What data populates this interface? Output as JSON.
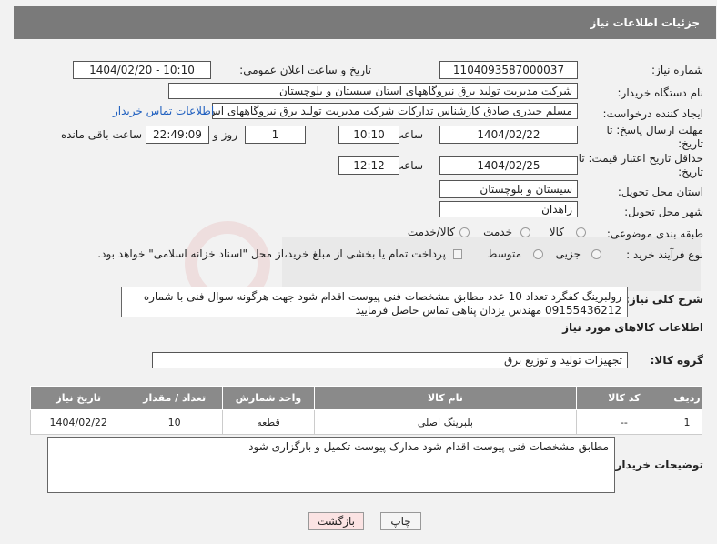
{
  "header": {
    "title": "جزئیات اطلاعات نیاز"
  },
  "fields": {
    "need_number": {
      "label": "شماره نیاز:",
      "value": "1104093587000037"
    },
    "announce": {
      "label": "تاریخ و ساعت اعلان عمومی:",
      "value": "1404/02/20 - 10:10"
    },
    "buyer_org": {
      "label": "نام دستگاه خریدار:",
      "value": "شرکت مدیریت تولید برق نیروگاههای استان سیستان و بلوچستان"
    },
    "creator": {
      "label": "ایجاد کننده درخواست:",
      "value": "مسلم حیدری صادق کارشناس تدارکات شرکت مدیریت تولید برق نیروگاههای اس",
      "contact_link": "اطلاعات تماس خریدار"
    },
    "deadline": {
      "label": "مهلت ارسال پاسخ: تا تاریخ:",
      "date": "1404/02/22",
      "time_label": "ساعت",
      "time": "10:10",
      "days": "1",
      "days_label": "روز و",
      "remaining": "22:49:09",
      "remaining_label": "ساعت باقی مانده"
    },
    "price_validity": {
      "label": "حداقل تاریخ اعتبار قیمت: تا تاریخ:",
      "date": "1404/02/25",
      "time_label": "ساعت",
      "time": "12:12"
    },
    "province": {
      "label": "استان محل تحویل:",
      "value": "سیستان و بلوچستان"
    },
    "city": {
      "label": "شهر محل تحویل:",
      "value": "زاهدان"
    },
    "category": {
      "label": "طبقه بندی موضوعی:",
      "options": [
        "کالا",
        "خدمت",
        "کالا/خدمت"
      ],
      "selected": "کالا"
    },
    "process": {
      "label": "نوع فرآیند خرید :",
      "options": [
        "جزیی",
        "متوسط"
      ],
      "selected": "جزیی",
      "checkbox_text": "پرداخت تمام یا بخشی از مبلغ خرید،از محل \"اسناد خزانه اسلامی\" خواهد بود."
    }
  },
  "summary": {
    "label": "شرح کلی نیاز:",
    "text": "رولبرینگ کفگرد  تعداد  10 عدد   مطابق مشخصات فنی پیوست اقدام شود جهت هرگونه سوال فنی با شماره 09155436212 مهندس یزدان پناهی تماس حاصل فرمایید"
  },
  "goods_info_title": "اطلاعات کالاهای مورد نیاز",
  "goods_group": {
    "label": "گروه کالا:",
    "value": "تجهیزات تولید و توزیع برق"
  },
  "table": {
    "headers": [
      "ردیف",
      "کد کالا",
      "نام کالا",
      "واحد شمارش",
      "تعداد / مقدار",
      "تاریخ نیاز"
    ],
    "rows": [
      [
        "1",
        "--",
        "بلبرینگ اصلی",
        "قطعه",
        "10",
        "1404/02/22"
      ]
    ]
  },
  "buyer_notes": {
    "label": "توضیحات خریدار:",
    "text": "مطابق مشخصات فنی پیوست اقدام شود مدارک پیوست تکمیل و بارگزاری شود"
  },
  "buttons": {
    "print": "چاپ",
    "back": "بازگشت"
  },
  "colors": {
    "header_bg": "#7a7a7a",
    "link": "#1f5fbf",
    "back_btn_bg": "#fbe3e3"
  }
}
